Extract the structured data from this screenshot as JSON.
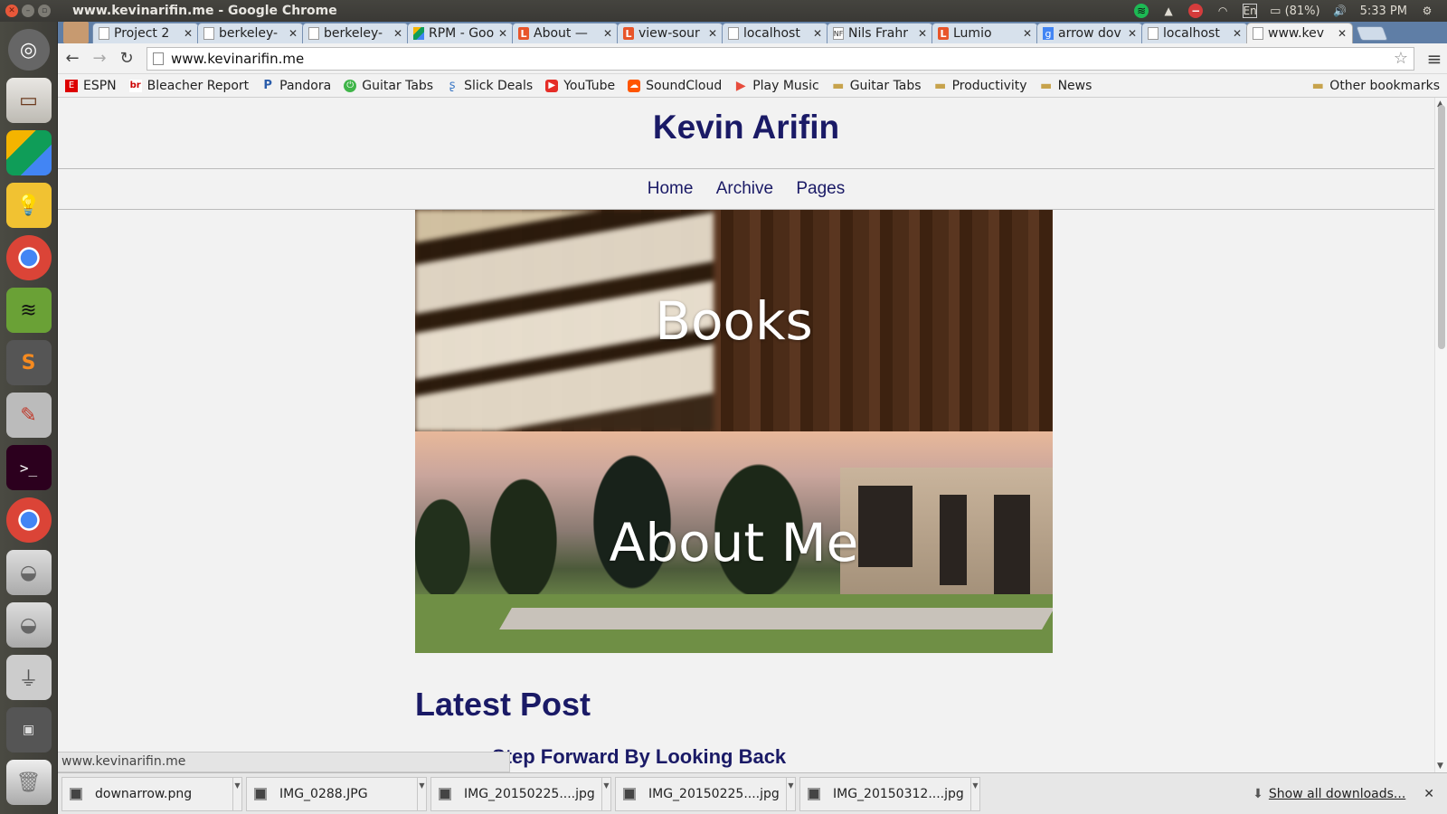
{
  "os": {
    "window_title": "www.kevinarifin.me - Google Chrome",
    "battery": "(81%)",
    "clock": "5:33 PM",
    "lang": "En"
  },
  "tabs": [
    {
      "label": "Project 2",
      "favicon": "page-icon"
    },
    {
      "label": "berkeley-",
      "favicon": "page-icon"
    },
    {
      "label": "berkeley-",
      "favicon": "page-icon"
    },
    {
      "label": "RPM - Goo",
      "favicon": "drive-icon"
    },
    {
      "label": "About —",
      "favicon": "lumio-icon"
    },
    {
      "label": "view-sour",
      "favicon": "lumio-icon"
    },
    {
      "label": "localhost",
      "favicon": "page-icon"
    },
    {
      "label": "Nils Frahr",
      "favicon": "nf-icon"
    },
    {
      "label": "Lumio",
      "favicon": "lumio-icon"
    },
    {
      "label": "arrow dov",
      "favicon": "google-icon"
    },
    {
      "label": "localhost",
      "favicon": "page-icon"
    },
    {
      "label": "www.kev",
      "favicon": "page-icon",
      "active": true
    }
  ],
  "toolbar": {
    "url": "www.kevinarifin.me"
  },
  "bookmarks": {
    "items": [
      {
        "label": "ESPN"
      },
      {
        "label": "Bleacher Report"
      },
      {
        "label": "Pandora"
      },
      {
        "label": "Guitar Tabs"
      },
      {
        "label": "Slick Deals"
      },
      {
        "label": "YouTube"
      },
      {
        "label": "SoundCloud"
      },
      {
        "label": "Play Music"
      },
      {
        "label": "Guitar Tabs"
      },
      {
        "label": "Productivity"
      },
      {
        "label": "News"
      }
    ],
    "other": "Other bookmarks"
  },
  "site": {
    "title": "Kevin Arifin",
    "nav": [
      "Home",
      "Archive",
      "Pages"
    ],
    "panels": [
      "Books",
      "About Me"
    ],
    "latest_heading": "Latest Post",
    "latest_post_title": "Step Forward By Looking Back"
  },
  "status_url": "www.kevinarifin.me",
  "downloads": {
    "items": [
      "downarrow.png",
      "IMG_0288.JPG",
      "IMG_20150225....jpg",
      "IMG_20150225....jpg",
      "IMG_20150312....jpg"
    ],
    "show_all": "Show all downloads..."
  }
}
